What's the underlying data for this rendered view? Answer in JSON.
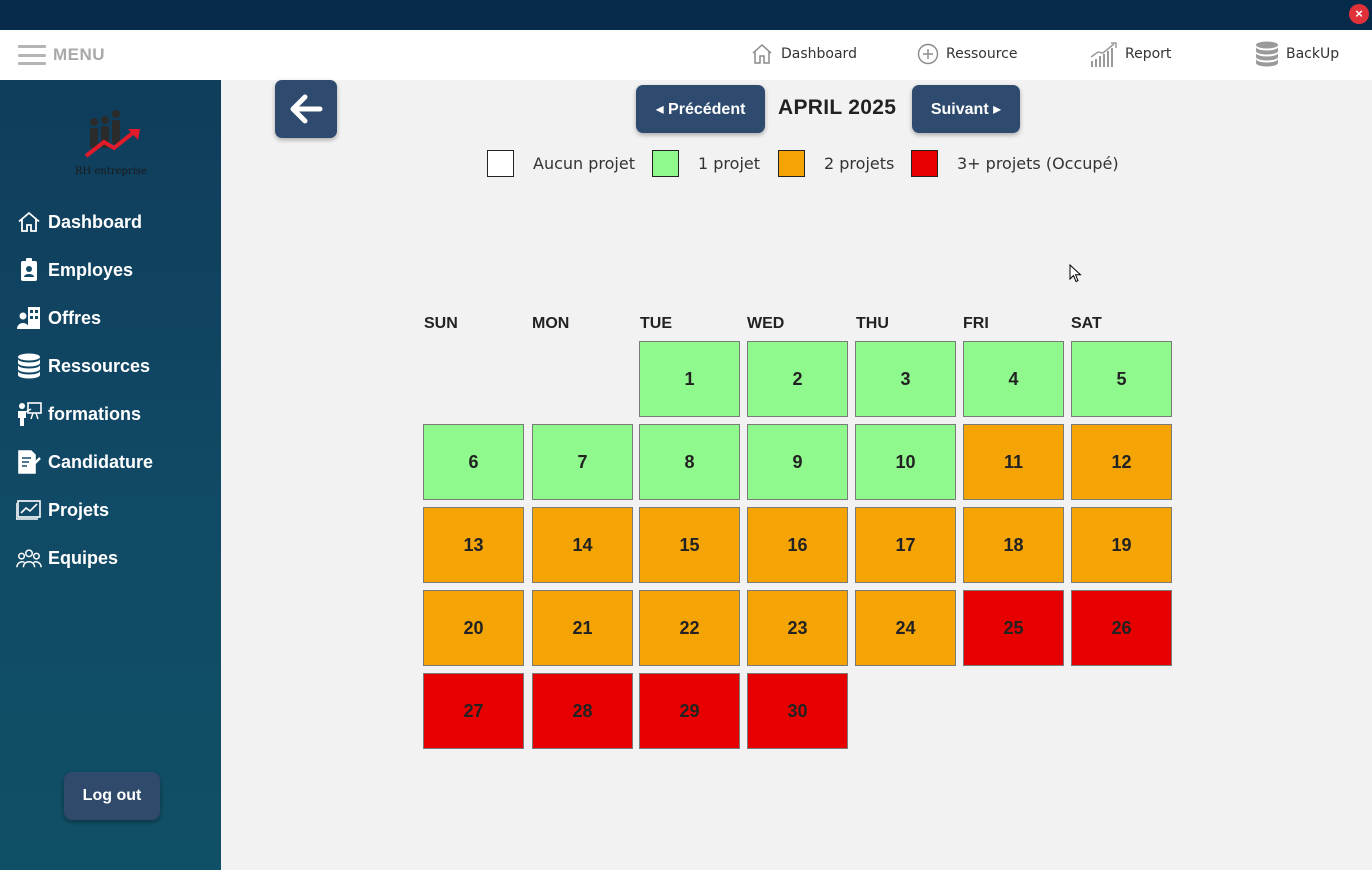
{
  "window": {
    "close_label": "×"
  },
  "topbar": {
    "menu_label": "MENU",
    "items": [
      {
        "label": "Dashboard",
        "icon": "home-icon"
      },
      {
        "label": "Ressource",
        "icon": "plus-circle-icon"
      },
      {
        "label": "Report",
        "icon": "chart-icon"
      },
      {
        "label": "BackUp",
        "icon": "database-icon"
      }
    ]
  },
  "sidebar": {
    "logo_text": "RH entreprise",
    "items": [
      {
        "label": "Dashboard",
        "icon": "home-icon"
      },
      {
        "label": "Employes",
        "icon": "id-badge-icon"
      },
      {
        "label": "Offres",
        "icon": "building-person-icon"
      },
      {
        "label": "Ressources",
        "icon": "database-icon"
      },
      {
        "label": "formations",
        "icon": "presentation-icon"
      },
      {
        "label": "Candidature",
        "icon": "document-sign-icon"
      },
      {
        "label": "Projets",
        "icon": "chart-board-icon"
      },
      {
        "label": "Equipes",
        "icon": "team-icon"
      }
    ],
    "logout_label": "Log out"
  },
  "calendar": {
    "prev_label": "◂ Précédent",
    "next_label": "Suivant ▸",
    "month_title": "APRIL 2025",
    "legend": [
      {
        "label": "Aucun projet",
        "color": "#ffffff"
      },
      {
        "label": "1 projet",
        "color": "#90f98e"
      },
      {
        "label": "2 projets",
        "color": "#f5a405"
      },
      {
        "label": "3+ projets (Occupé)",
        "color": "#e60000"
      }
    ],
    "weekdays": [
      "SUN",
      "MON",
      "TUE",
      "WED",
      "THU",
      "FRI",
      "SAT"
    ],
    "first_weekday_index": 2,
    "days": [
      {
        "day": "1",
        "level": 1
      },
      {
        "day": "2",
        "level": 1
      },
      {
        "day": "3",
        "level": 1
      },
      {
        "day": "4",
        "level": 1
      },
      {
        "day": "5",
        "level": 1
      },
      {
        "day": "6",
        "level": 1
      },
      {
        "day": "7",
        "level": 1
      },
      {
        "day": "8",
        "level": 1
      },
      {
        "day": "9",
        "level": 1
      },
      {
        "day": "10",
        "level": 1
      },
      {
        "day": "11",
        "level": 2
      },
      {
        "day": "12",
        "level": 2
      },
      {
        "day": "13",
        "level": 2
      },
      {
        "day": "14",
        "level": 2
      },
      {
        "day": "15",
        "level": 2
      },
      {
        "day": "16",
        "level": 2
      },
      {
        "day": "17",
        "level": 2
      },
      {
        "day": "18",
        "level": 2
      },
      {
        "day": "19",
        "level": 2
      },
      {
        "day": "20",
        "level": 2
      },
      {
        "day": "21",
        "level": 2
      },
      {
        "day": "22",
        "level": 2
      },
      {
        "day": "23",
        "level": 2
      },
      {
        "day": "24",
        "level": 2
      },
      {
        "day": "25",
        "level": 3
      },
      {
        "day": "26",
        "level": 3
      },
      {
        "day": "27",
        "level": 3
      },
      {
        "day": "28",
        "level": 3
      },
      {
        "day": "29",
        "level": 3
      },
      {
        "day": "30",
        "level": 3
      }
    ]
  }
}
